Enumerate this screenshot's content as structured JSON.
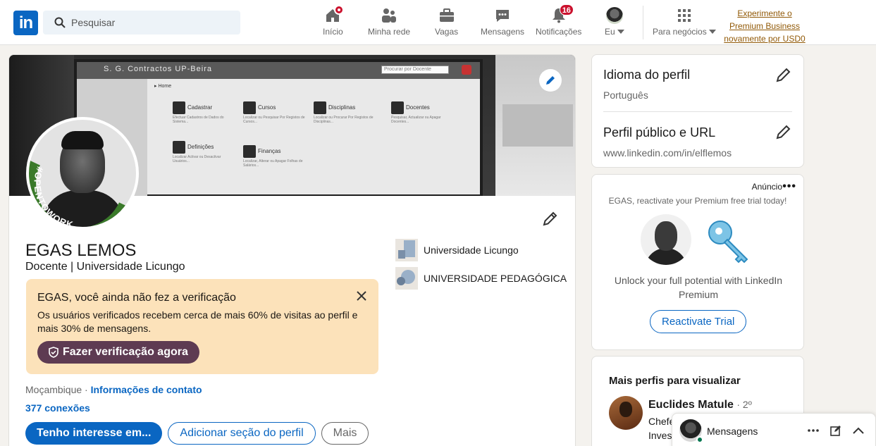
{
  "header": {
    "logo_text": "in",
    "search": {
      "placeholder": "Pesquisar"
    },
    "nav": [
      {
        "label": "Início",
        "icon": "home-icon"
      },
      {
        "label": "Minha rede",
        "icon": "network-icon"
      },
      {
        "label": "Vagas",
        "icon": "briefcase-icon"
      },
      {
        "label": "Mensagens",
        "icon": "chat-icon"
      },
      {
        "label": "Notificações",
        "icon": "bell-icon",
        "badge": "16"
      },
      {
        "label": "Eu",
        "icon": "avatar"
      },
      {
        "label": "Para negócios",
        "icon": "grid-icon"
      }
    ],
    "premium_link": [
      "Experimente o",
      "Premium Business",
      "novamente por USD0"
    ]
  },
  "profile": {
    "name": "EGAS LEMOS",
    "headline": "Docente | Universidade Licungo",
    "open_to_work": "#OPENTOWORK",
    "education": [
      {
        "name": "Universidade Licungo"
      },
      {
        "name": "UNIVERSIDADE PEDAGÓGICA"
      }
    ],
    "banner": {
      "app_title": "S. G. Contractos UP-Beira",
      "search_placeholder": "Procurar por Docente",
      "breadcrumb": "Home",
      "tiles": [
        {
          "label": "Cadastrar",
          "desc": "Efectuar Cadastros de Dados do Sistema..."
        },
        {
          "label": "Cursos",
          "desc": "Localizar ou Pesquisar Por Registos de Cursos..."
        },
        {
          "label": "Disciplinas",
          "desc": "Localizar ou Procurar Por Registos de Disciplinas..."
        },
        {
          "label": "Docentes",
          "desc": "Pesquisar, Actualizar ou Apagar Docentes..."
        },
        {
          "label": "Definições",
          "desc": "Localizar Activar ou Desactivar Usuários..."
        },
        {
          "label": "Finanças",
          "desc": "Localizar, Alterar ou Apagar Folhas de Salários..."
        }
      ]
    },
    "verification": {
      "title": "EGAS, você ainda não fez a verificação",
      "text": "Os usuários verificados recebem cerca de mais 60% de visitas ao perfil e mais 30% de mensagens.",
      "button": "Fazer verificação agora"
    },
    "location": "Moçambique",
    "location_sep": " · ",
    "contact_info": "Informações de contato",
    "connections": "377 conexões",
    "actions": {
      "primary": "Tenho interesse em...",
      "secondary": "Adicionar seção do perfil",
      "more": "Mais"
    }
  },
  "sidebar": {
    "language": {
      "title": "Idioma do perfil",
      "value": "Português"
    },
    "public_url": {
      "title": "Perfil público e URL",
      "value": "www.linkedin.com/in/elflemos"
    },
    "ad": {
      "label": "Anúncio",
      "more": "•••",
      "subtitle": "EGAS, reactivate your Premium free trial today!",
      "text": "Unlock your full potential with LinkedIn Premium",
      "button": "Reactivate Trial"
    },
    "more_profiles": {
      "title": "Mais perfis para visualizar",
      "items": [
        {
          "name": "Euclides Matule",
          "degree": "· 2º",
          "headline_line1": "Chefe",
          "headline_line2": "Invest"
        }
      ]
    }
  },
  "messaging": {
    "label": "Mensagens"
  },
  "colors": {
    "brand": "#0a66c2",
    "badge": "#cb112d",
    "verify_bg": "#fce2ba",
    "verify_btn": "#5e3b52",
    "open_to_work": "#3a7a2a",
    "premium_link": "#915907"
  }
}
